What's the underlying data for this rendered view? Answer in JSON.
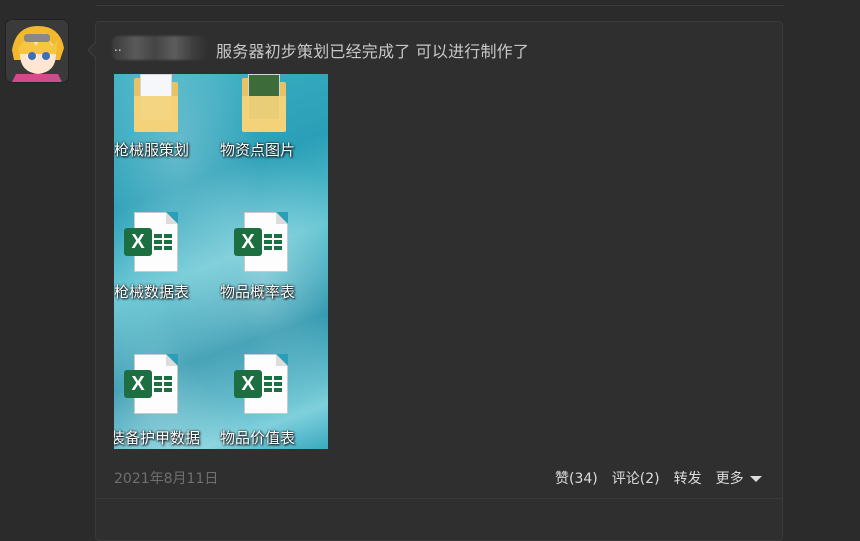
{
  "post": {
    "author_placeholder": "..",
    "text": "服务器初步策划已经完成了 可以进行制作了",
    "date": "2021年8月11日"
  },
  "attachment": {
    "icons": [
      {
        "type": "folder",
        "label": "枪械服策划"
      },
      {
        "type": "folder",
        "label": "物资点图片"
      },
      {
        "type": "xls",
        "label": "枪械数据表"
      },
      {
        "type": "xls",
        "label": "物品概率表"
      },
      {
        "type": "xls",
        "label": "装备护甲数据"
      },
      {
        "type": "xls",
        "label": "物品价值表"
      }
    ]
  },
  "actions": {
    "like": "赞(34)",
    "comment": "评论(2)",
    "forward": "转发",
    "more": "更多"
  }
}
